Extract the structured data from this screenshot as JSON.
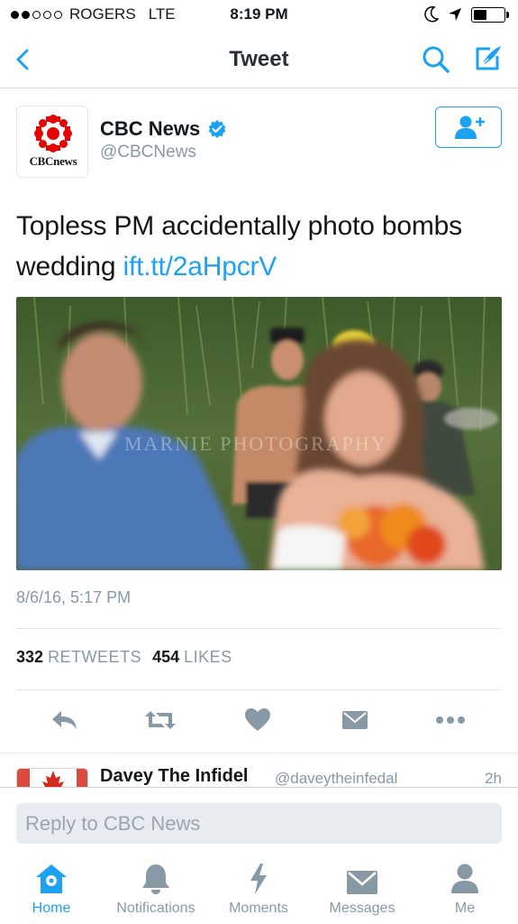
{
  "status_bar": {
    "carrier": "ROGERS",
    "network": "LTE",
    "time": "8:19 PM",
    "signal_bars": 5,
    "signal_filled": 2
  },
  "nav": {
    "title": "Tweet",
    "back_icon": "chevron-left-icon",
    "search_icon": "search-icon",
    "compose_icon": "compose-tweet-icon",
    "accent_color": "#1da1f2"
  },
  "tweet": {
    "author_name": "CBC News",
    "author_handle": "@CBCNews",
    "verified": true,
    "avatar_text": "CBCnews",
    "text": "Topless PM accidentally photo bombs wedding ",
    "link": "ift.tt/2aHpcrV",
    "timestamp": "8/6/16, 5:17 PM",
    "retweets_count": "332",
    "retweets_label": "RETWEETS",
    "likes_count": "454",
    "likes_label": "LIKES",
    "photo_watermark": "MARNIE PHOTOGRAPHY"
  },
  "actions": [
    "reply-icon",
    "retweet-icon",
    "like-icon",
    "direct-message-icon",
    "more-icon"
  ],
  "reply_preview": {
    "name": "Davey The Infidel",
    "handle": "@daveytheinfedal",
    "time": "2h"
  },
  "reply_bar": {
    "placeholder": "Reply to CBC News"
  },
  "tabs": [
    {
      "label": "Home",
      "icon": "home-icon",
      "active": true
    },
    {
      "label": "Notifications",
      "icon": "bell-icon",
      "active": false
    },
    {
      "label": "Moments",
      "icon": "lightning-icon",
      "active": false
    },
    {
      "label": "Messages",
      "icon": "envelope-icon",
      "active": false
    },
    {
      "label": "Me",
      "icon": "person-icon",
      "active": false
    }
  ]
}
